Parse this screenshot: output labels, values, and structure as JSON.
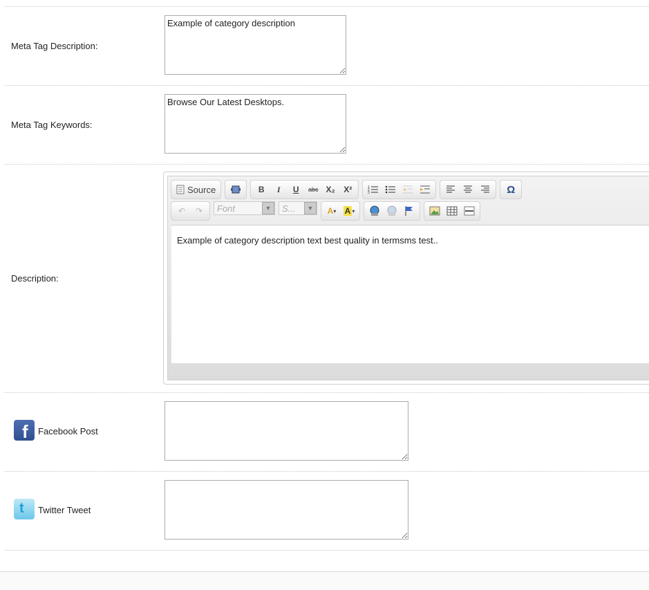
{
  "meta_description": {
    "label": "Meta Tag Description:",
    "value": "Example of category description"
  },
  "meta_keywords": {
    "label": "Meta Tag Keywords:",
    "value": "Browse Our Latest Desktops."
  },
  "description": {
    "label": "Description:",
    "toolbar": {
      "source_label": "Source",
      "bold": "B",
      "italic": "I",
      "underline": "U",
      "strike": "abc",
      "subscript": "X₂",
      "superscript": "X²",
      "font_placeholder": "Font",
      "size_placeholder": "S..."
    },
    "content": "Example of category description text best quality in termsms test.."
  },
  "facebook": {
    "label": "Facebook Post",
    "value": ""
  },
  "twitter": {
    "label": "Twitter Tweet",
    "value": ""
  }
}
